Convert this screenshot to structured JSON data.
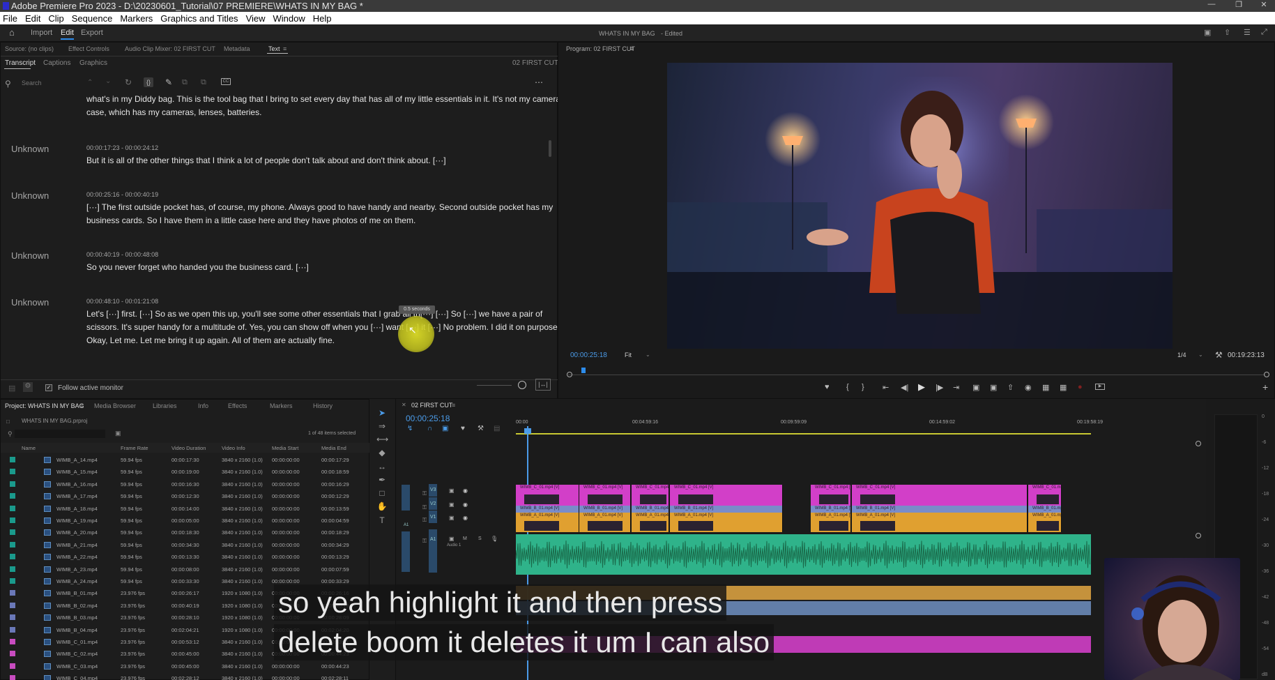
{
  "titlebar": {
    "title": "Adobe Premiere Pro 2023 - D:\\20230601_Tutorial\\07 PREMIERE\\WHATS IN MY BAG *"
  },
  "menu": [
    "File",
    "Edit",
    "Clip",
    "Sequence",
    "Markers",
    "Graphics and Titles",
    "View",
    "Window",
    "Help"
  ],
  "workspace": {
    "import": "Import",
    "edit": "Edit",
    "export": "Export",
    "project_title": "WHATS IN MY BAG",
    "status": "- Edited"
  },
  "source_tabs": {
    "source": "Source: (no clips)",
    "effect_controls": "Effect Controls",
    "audio_mixer": "Audio Clip Mixer: 02 FIRST CUT",
    "metadata": "Metadata",
    "text": "Text"
  },
  "text_subtabs": {
    "transcript": "Transcript",
    "captions": "Captions",
    "graphics": "Graphics",
    "sequence": "02 FIRST CUT"
  },
  "search": {
    "placeholder": "Search"
  },
  "transcript": [
    {
      "speaker": "",
      "timecode": "",
      "lines": [
        "what's in my Diddy bag. This is the tool bag that I bring to set every day that has all of my little essentials in it. It's not my camera",
        "case, which has my cameras, lenses, batteries."
      ]
    },
    {
      "speaker": "Unknown",
      "timecode": "00:00:17:23 - 00:00:24:12",
      "lines": [
        "But it is all of the other things that I think a lot of people don't talk about and don't think about. [···]"
      ]
    },
    {
      "speaker": "Unknown",
      "timecode": "00:00:25:16 - 00:00:40:19",
      "lines": [
        "[···] The first outside pocket has, of course, my phone. Always good to have handy and nearby. Second outside pocket has my",
        "business cards. So I have them in a little case here and they have photos of me on them."
      ]
    },
    {
      "speaker": "Unknown",
      "timecode": "00:00:40:19 - 00:00:48:08",
      "lines": [
        "So you never forget who handed you the business card. [···]"
      ]
    },
    {
      "speaker": "Unknown",
      "timecode": "00:00:48:10 - 00:01:21:08",
      "lines": [
        "Let's [···] first. [···] So as we open this up, you'll see some other essentials that I grab all th[···] [···] So [···] we have a pair of",
        "scissors. It's super handy for a multitude of. Yes, you can show off when you [···] want [···] it [···] No problem. I did it on purpose.",
        "Okay, Let me. Let me bring it up again. All of them are actually fine."
      ]
    }
  ],
  "tooltip": "0.5 seconds",
  "follow_monitor": "Follow active monitor",
  "program": {
    "label": "Program: 02 FIRST CUT",
    "timecode": "00:00:25:18",
    "fit": "Fit",
    "resolution": "1/4",
    "duration": "00:19:23:13"
  },
  "project_tabs": {
    "project": "Project: WHATS IN MY BAG",
    "media_browser": "Media Browser",
    "libraries": "Libraries",
    "info": "Info",
    "effects": "Effects",
    "markers": "Markers",
    "history": "History"
  },
  "project": {
    "file": "WHATS IN MY BAG.prproj",
    "selection": "1 of 48 items selected",
    "columns": [
      "Name",
      "Frame Rate",
      "Video Duration",
      "Video Info",
      "Media Start",
      "Media End"
    ],
    "rows": [
      {
        "name": "WIMB_A_14.mp4",
        "fps": "59.94 fps",
        "dur": "00:00:17:30",
        "info": "3840 x 2160 (1.0)",
        "start": "00:00:00:00",
        "end": "00:00:17:29",
        "color": "#1a9a8c"
      },
      {
        "name": "WIMB_A_15.mp4",
        "fps": "59.94 fps",
        "dur": "00:00:19:00",
        "info": "3840 x 2160 (1.0)",
        "start": "00:00:00:00",
        "end": "00:00:18:59",
        "color": "#1a9a8c"
      },
      {
        "name": "WIMB_A_16.mp4",
        "fps": "59.94 fps",
        "dur": "00:00:16:30",
        "info": "3840 x 2160 (1.0)",
        "start": "00:00:00:00",
        "end": "00:00:16:29",
        "color": "#1a9a8c"
      },
      {
        "name": "WIMB_A_17.mp4",
        "fps": "59.94 fps",
        "dur": "00:00:12:30",
        "info": "3840 x 2160 (1.0)",
        "start": "00:00:00:00",
        "end": "00:00:12:29",
        "color": "#1a9a8c"
      },
      {
        "name": "WIMB_A_18.mp4",
        "fps": "59.94 fps",
        "dur": "00:00:14:00",
        "info": "3840 x 2160 (1.0)",
        "start": "00:00:00:00",
        "end": "00:00:13:59",
        "color": "#1a9a8c"
      },
      {
        "name": "WIMB_A_19.mp4",
        "fps": "59.94 fps",
        "dur": "00:00:05:00",
        "info": "3840 x 2160 (1.0)",
        "start": "00:00:00:00",
        "end": "00:00:04:59",
        "color": "#1a9a8c"
      },
      {
        "name": "WIMB_A_20.mp4",
        "fps": "59.94 fps",
        "dur": "00:00:18:30",
        "info": "3840 x 2160 (1.0)",
        "start": "00:00:00:00",
        "end": "00:00:18:29",
        "color": "#1a9a8c"
      },
      {
        "name": "WIMB_A_21.mp4",
        "fps": "59.94 fps",
        "dur": "00:00:34:30",
        "info": "3840 x 2160 (1.0)",
        "start": "00:00:00:00",
        "end": "00:00:34:29",
        "color": "#1a9a8c"
      },
      {
        "name": "WIMB_A_22.mp4",
        "fps": "59.94 fps",
        "dur": "00:00:13:30",
        "info": "3840 x 2160 (1.0)",
        "start": "00:00:00:00",
        "end": "00:00:13:29",
        "color": "#1a9a8c"
      },
      {
        "name": "WIMB_A_23.mp4",
        "fps": "59.94 fps",
        "dur": "00:00:08:00",
        "info": "3840 x 2160 (1.0)",
        "start": "00:00:00:00",
        "end": "00:00:07:59",
        "color": "#1a9a8c"
      },
      {
        "name": "WIMB_A_24.mp4",
        "fps": "59.94 fps",
        "dur": "00:00:33:30",
        "info": "3840 x 2160 (1.0)",
        "start": "00:00:00:00",
        "end": "00:00:33:29",
        "color": "#1a9a8c"
      },
      {
        "name": "WIMB_B_01.mp4",
        "fps": "23.976 fps",
        "dur": "00:00:26:17",
        "info": "1920 x 1080 (1.0)",
        "start": "00:00:00:00",
        "end": "00:00:26:16",
        "color": "#6a78b8"
      },
      {
        "name": "WIMB_B_02.mp4",
        "fps": "23.976 fps",
        "dur": "00:00:40:19",
        "info": "1920 x 1080 (1.0)",
        "start": "00:00:00:00",
        "end": "00:00:40:18",
        "color": "#6a78b8"
      },
      {
        "name": "WIMB_B_03.mp4",
        "fps": "23.976 fps",
        "dur": "00:00:28:10",
        "info": "1920 x 1080 (1.0)",
        "start": "00:00:00:00",
        "end": "00:00:28:09",
        "color": "#6a78b8"
      },
      {
        "name": "WIMB_B_04.mp4",
        "fps": "23.976 fps",
        "dur": "00:02:04:21",
        "info": "1920 x 1080 (1.0)",
        "start": "00:00:00:00",
        "end": "00:02:04:20",
        "color": "#6a78b8"
      },
      {
        "name": "WIMB_C_01.mp4",
        "fps": "23.976 fps",
        "dur": "00:00:53:12",
        "info": "3840 x 2160 (1.0)",
        "start": "00:00:00:00",
        "end": "00:00:53:11",
        "color": "#c84cc0"
      },
      {
        "name": "WIMB_C_02.mp4",
        "fps": "23.976 fps",
        "dur": "00:00:45:00",
        "info": "3840 x 2160 (1.0)",
        "start": "00:00:00:00",
        "end": "00:00:44:23",
        "color": "#c84cc0"
      },
      {
        "name": "WIMB_C_03.mp4",
        "fps": "23.976 fps",
        "dur": "00:00:45:00",
        "info": "3840 x 2160 (1.0)",
        "start": "00:00:00:00",
        "end": "00:00:44:23",
        "color": "#c84cc0"
      },
      {
        "name": "WIMB_C_04.mp4",
        "fps": "23.976 fps",
        "dur": "00:02:28:12",
        "info": "3840 x 2160 (1.0)",
        "start": "00:00:00:00",
        "end": "00:02:28:11",
        "color": "#c84cc0"
      }
    ]
  },
  "timeline": {
    "sequence": "02 FIRST CUT",
    "timecode": "00:00:25:18",
    "ruler": [
      "00:00",
      "00:04:59:16",
      "00:09:59:09",
      "00:14:59:02",
      "00:19:58:19"
    ],
    "tracks": {
      "v3": "V3",
      "v2": "V2",
      "v1": "V1",
      "a1": "A1",
      "audio_label": "Audio 1"
    }
  },
  "clip_labels": {
    "v3": "WIMB_C_01.mp4 [V]",
    "v2": "WIMB_B_01.mp4 [V]",
    "v1": "WIMB_A_01.mp4 [V]"
  },
  "captions": [
    "so yeah highlight it and then press",
    "delete boom it deletes it um I can also"
  ],
  "meter_scale": [
    "0",
    "-6",
    "-12",
    "-18",
    "-24",
    "-30",
    "-36",
    "-42",
    "-48",
    "-54",
    "dB"
  ],
  "colors": {
    "accent": "#2d8ceb",
    "v3": "#d23fc8",
    "v2": "#7a8cc8",
    "v1": "#e0a030",
    "audio": "#2fb38a"
  }
}
